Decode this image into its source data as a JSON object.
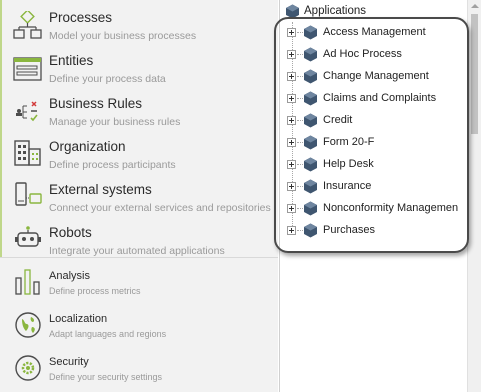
{
  "nav": {
    "processes": {
      "title": "Processes",
      "subtitle": "Model your business processes"
    },
    "entities": {
      "title": "Entities",
      "subtitle": "Define your process data"
    },
    "business_rules": {
      "title": "Business Rules",
      "subtitle": "Manage your business rules"
    },
    "organization": {
      "title": "Organization",
      "subtitle": "Define process participants"
    },
    "external_systems": {
      "title": "External systems",
      "subtitle": "Connect your external services and repositories"
    },
    "robots": {
      "title": "Robots",
      "subtitle": "Integrate your automated applications"
    },
    "analysis": {
      "title": "Analysis",
      "subtitle": "Define process metrics"
    },
    "localization": {
      "title": "Localization",
      "subtitle": "Adapt languages and regions"
    },
    "security": {
      "title": "Security",
      "subtitle": "Define your security settings"
    }
  },
  "tree": {
    "root_label": "Applications",
    "items": [
      {
        "label": "Access Management"
      },
      {
        "label": "Ad Hoc Process"
      },
      {
        "label": "Change Management"
      },
      {
        "label": "Claims and Complaints"
      },
      {
        "label": "Credit"
      },
      {
        "label": "Form 20-F"
      },
      {
        "label": "Help Desk"
      },
      {
        "label": "Insurance"
      },
      {
        "label": "Nonconformity Managemen"
      },
      {
        "label": "Purchases"
      }
    ]
  },
  "colors": {
    "accent_green": "#8ab63f",
    "icon_gray": "#4d4d4d",
    "hex_blue": "#3f5670"
  }
}
